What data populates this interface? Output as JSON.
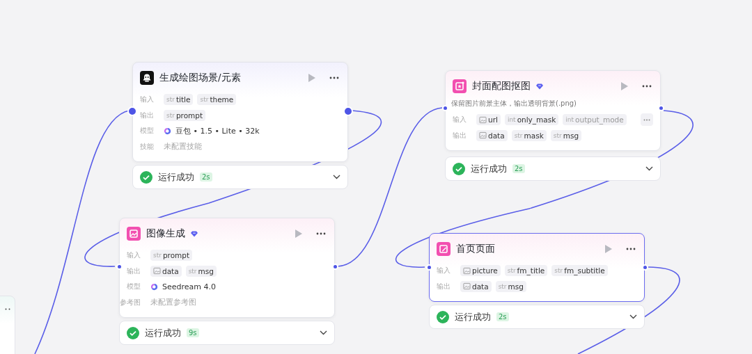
{
  "nodes": [
    {
      "title": "生成绘图场景/元素",
      "premium": false,
      "selected": false,
      "rows": [
        {
          "kind": "params",
          "label": "输入",
          "params": [
            {
              "kind": "typed",
              "type_label": "str",
              "name": "title"
            },
            {
              "kind": "typed",
              "type_label": "str",
              "name": "theme"
            }
          ]
        },
        {
          "kind": "params",
          "label": "输出",
          "params": [
            {
              "kind": "typed",
              "type_label": "str",
              "name": "prompt"
            }
          ]
        },
        {
          "kind": "model",
          "label": "模型",
          "value": "豆包 • 1.5 • Lite • 32k"
        },
        {
          "kind": "text",
          "label": "技能",
          "value": "未配置技能"
        }
      ],
      "status": {
        "text": "运行成功",
        "duration": "2s"
      }
    },
    {
      "title": "图像生成",
      "premium": true,
      "selected": false,
      "rows": [
        {
          "kind": "params",
          "label": "输入",
          "params": [
            {
              "kind": "typed",
              "type_label": "str",
              "name": "prompt"
            }
          ]
        },
        {
          "kind": "params",
          "label": "输出",
          "params": [
            {
              "kind": "image",
              "name": "data"
            },
            {
              "kind": "typed",
              "type_label": "str",
              "name": "msg"
            }
          ]
        },
        {
          "kind": "model",
          "label": "模型",
          "value": "Seedream 4.0"
        },
        {
          "kind": "text",
          "label": "参考图",
          "value": "未配置参考图"
        }
      ],
      "status": {
        "text": "运行成功",
        "duration": "9s"
      }
    },
    {
      "title": "封面配图抠图",
      "premium": true,
      "selected": false,
      "description": "保留图片前景主体，输出透明背景(.png)",
      "rows": [
        {
          "kind": "params",
          "label": "输入",
          "overflow": true,
          "params": [
            {
              "kind": "image",
              "name": "url"
            },
            {
              "kind": "typed",
              "type_label": "int",
              "name": "only_mask"
            },
            {
              "kind": "typed",
              "type_label": "int",
              "name": "output_mode"
            }
          ]
        },
        {
          "kind": "params",
          "label": "输出",
          "params": [
            {
              "kind": "image",
              "name": "data"
            },
            {
              "kind": "typed",
              "type_label": "str",
              "name": "mask"
            },
            {
              "kind": "typed",
              "type_label": "str",
              "name": "msg"
            }
          ]
        }
      ],
      "status": {
        "text": "运行成功",
        "duration": "2s"
      }
    },
    {
      "title": "首页页面",
      "premium": false,
      "selected": true,
      "rows": [
        {
          "kind": "params",
          "label": "输入",
          "params": [
            {
              "kind": "image",
              "name": "picture"
            },
            {
              "kind": "typed",
              "type_label": "str",
              "name": "fm_title"
            },
            {
              "kind": "typed",
              "type_label": "str",
              "name": "fm_subtitle"
            }
          ]
        },
        {
          "kind": "params",
          "label": "输出",
          "params": [
            {
              "kind": "image",
              "name": "data"
            },
            {
              "kind": "typed",
              "type_label": "str",
              "name": "msg"
            }
          ]
        }
      ],
      "status": {
        "text": "运行成功",
        "duration": "2s"
      }
    }
  ]
}
